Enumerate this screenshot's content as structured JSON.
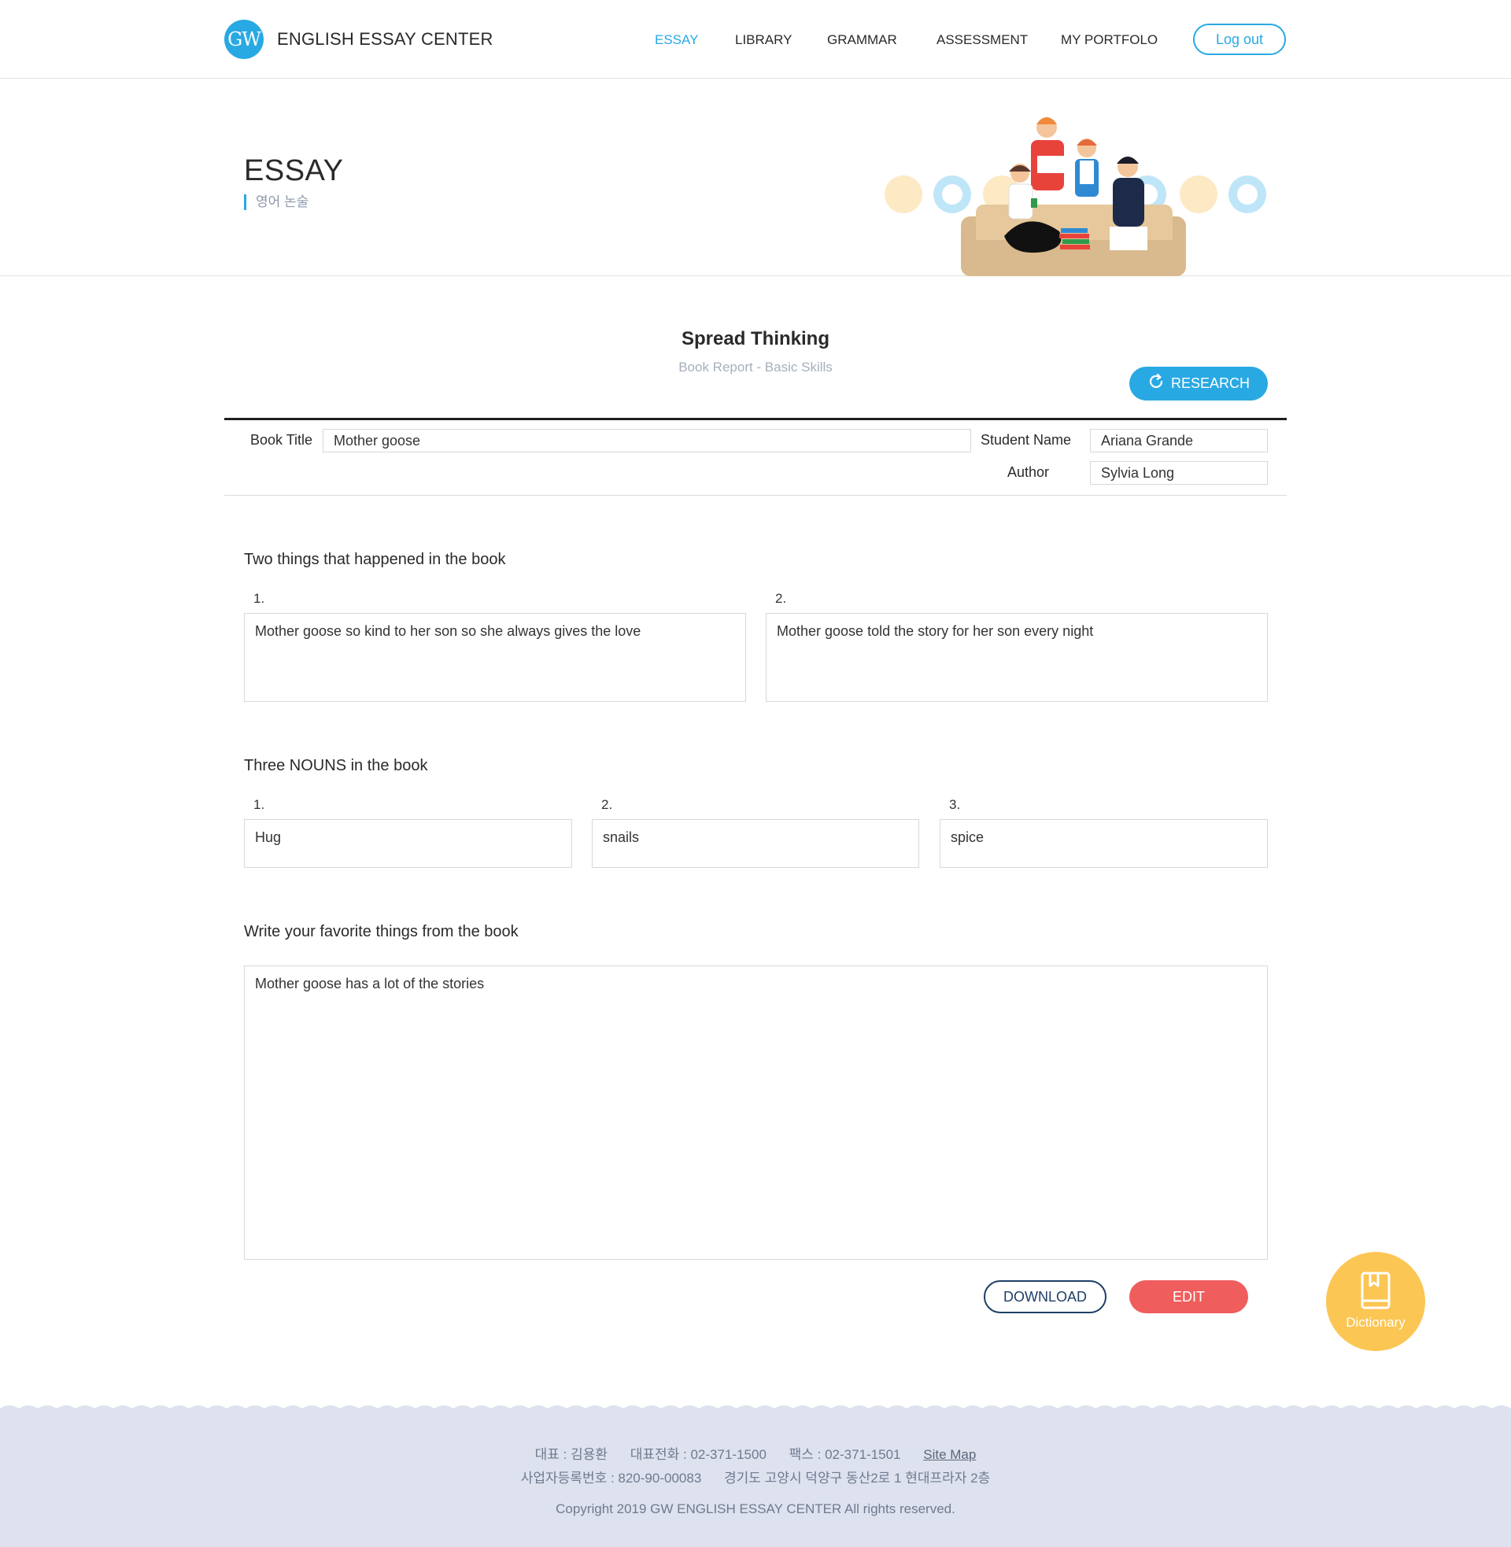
{
  "header": {
    "logo_text": "GW",
    "brand": "ENGLISH ESSAY CENTER",
    "nav": [
      "ESSAY",
      "LIBRARY",
      "GRAMMAR",
      "ASSESSMENT",
      "MY PORTFOLO"
    ],
    "active_nav": "ESSAY",
    "logout_label": "Log out"
  },
  "hero": {
    "title": "ESSAY",
    "subtitle": "영어 논술"
  },
  "section": {
    "title": "Spread Thinking",
    "subtitle": "Book Report - Basic Skills",
    "research_label": "RESEARCH"
  },
  "form": {
    "book_title_label": "Book Title",
    "book_title_value": "Mother goose",
    "student_name_label": "Student Name",
    "student_name_value": "Ariana Grande",
    "author_label": "Author",
    "author_value": "Sylvia Long"
  },
  "q1": {
    "title": "Two things that happened in the book",
    "items": [
      {
        "num": "1.",
        "text": "Mother goose so kind to her son so she always gives the love"
      },
      {
        "num": "2.",
        "text": "Mother goose told the story for her son every night"
      }
    ]
  },
  "q2": {
    "title": "Three NOUNS in the book",
    "items": [
      {
        "num": "1.",
        "text": "Hug"
      },
      {
        "num": "2.",
        "text": "snails"
      },
      {
        "num": "3.",
        "text": "spice"
      }
    ]
  },
  "q3": {
    "title": "Write your favorite things from the book",
    "text": "Mother goose has a lot of the stories"
  },
  "actions": {
    "download_label": "DOWNLOAD",
    "edit_label": "EDIT"
  },
  "dictionary": {
    "label": "Dictionary"
  },
  "footer": {
    "ceo": "대표 : 김용환",
    "phone": "대표전화 : 02-371-1500",
    "fax": "팩스 : 02-371-1501",
    "sitemap": "Site Map",
    "biz_no": "사업자등록번호 : 820-90-00083",
    "address": "경기도 고양시 덕양구 동산2로 1 현대프라자 2층",
    "copyright": "Copyright 2019 GW ENGLISH ESSAY CENTER All rights reserved."
  },
  "colors": {
    "accent": "#29a9e3",
    "edit": "#ef5d5d",
    "dictionary": "#fcc654",
    "navy": "#1e3f66",
    "footer_bg": "#dde2ee"
  }
}
